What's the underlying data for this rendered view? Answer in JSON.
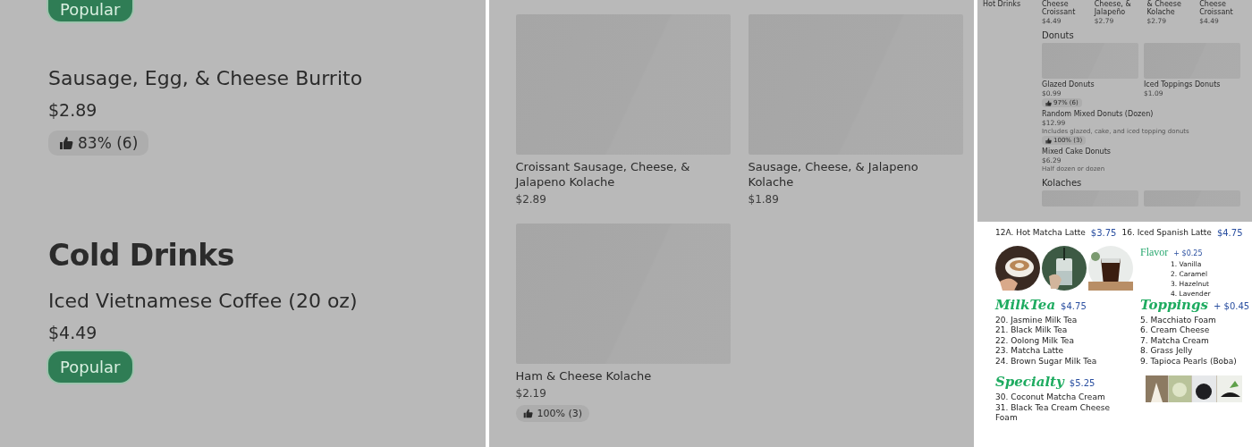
{
  "left_panel": {
    "top_badge": "Popular",
    "entries": [
      {
        "kind": "item",
        "name": "Sausage, Egg, & Cheese Burrito",
        "price": "$2.89",
        "rating": "83% (6)"
      },
      {
        "kind": "heading",
        "title": "Cold Drinks"
      },
      {
        "kind": "item",
        "name": "Iced Vietnamese Coffee (20 oz)",
        "price": "$4.49",
        "badge": "Popular"
      }
    ]
  },
  "middle_panel": {
    "cards": [
      {
        "name": "Croissant Sausage, Cheese, & Jalapeno Kolache",
        "price": "$2.89"
      },
      {
        "name": "Sausage, Cheese, & Jalapeno Kolache",
        "price": "$1.89"
      },
      {
        "name": "Ham & Cheese Kolache",
        "price": "$2.19",
        "rating": "100% (3)"
      }
    ]
  },
  "store_page": {
    "sidebar": {
      "items": [
        "Hot Drinks"
      ]
    },
    "top_row": [
      {
        "name": "Cheese Croissant",
        "price": "$4.49"
      },
      {
        "name": "Cheese, & Jalapeño",
        "price": "$2.79"
      },
      {
        "name": "& Cheese Kolache",
        "price": "$2.79"
      },
      {
        "name": "Cheese Croissant",
        "price": "$4.49"
      }
    ],
    "sections": [
      {
        "title": "Donuts",
        "cards": [
          {
            "name": "Glazed Donuts",
            "price": "$0.99",
            "rating": "97% (6)"
          },
          {
            "name": "Iced Toppings Donuts",
            "price": "$1.09"
          }
        ],
        "items": [
          {
            "name": "Random Mixed Donuts (Dozen)",
            "price": "$12.99",
            "description": "Includes glazed, cake, and iced topping donuts",
            "rating": "100% (3)"
          },
          {
            "name": "Mixed Cake Donuts",
            "price": "$6.29",
            "description": "Half dozen or dozen"
          }
        ]
      },
      {
        "title": "Kolaches"
      }
    ]
  },
  "menu_board": {
    "top_line": [
      {
        "name": "12A. Hot Matcha Latte",
        "price": "$3.75"
      },
      {
        "name": "16. Iced Spanish Latte",
        "price": "$4.75"
      }
    ],
    "flavor": {
      "title": "Flavor",
      "price": "+ $0.25",
      "items": [
        "1. Vanilla",
        "2. Caramel",
        "3. Hazelnut",
        "4. Lavender"
      ]
    },
    "milk_tea": {
      "title": "MilkTea",
      "price": "$4.75",
      "items": [
        "20. Jasmine Milk Tea",
        "21.  Black Milk Tea",
        "22. Oolong Milk Tea",
        "23. Matcha Latte",
        "24. Brown Sugar Milk Tea"
      ]
    },
    "toppings": {
      "title": "Toppings",
      "price": "+ $0.45",
      "items": [
        "5. Macchiato Foam",
        "6. Cream Cheese",
        "7. Matcha Cream",
        "8. Grass Jelly",
        "9. Tapioca Pearls (Boba)"
      ]
    },
    "specialty": {
      "title": "Specialty",
      "price": "$5.25",
      "items": [
        "30. Coconut Matcha Cream",
        "31. Black Tea Cream Cheese Foam"
      ]
    }
  }
}
